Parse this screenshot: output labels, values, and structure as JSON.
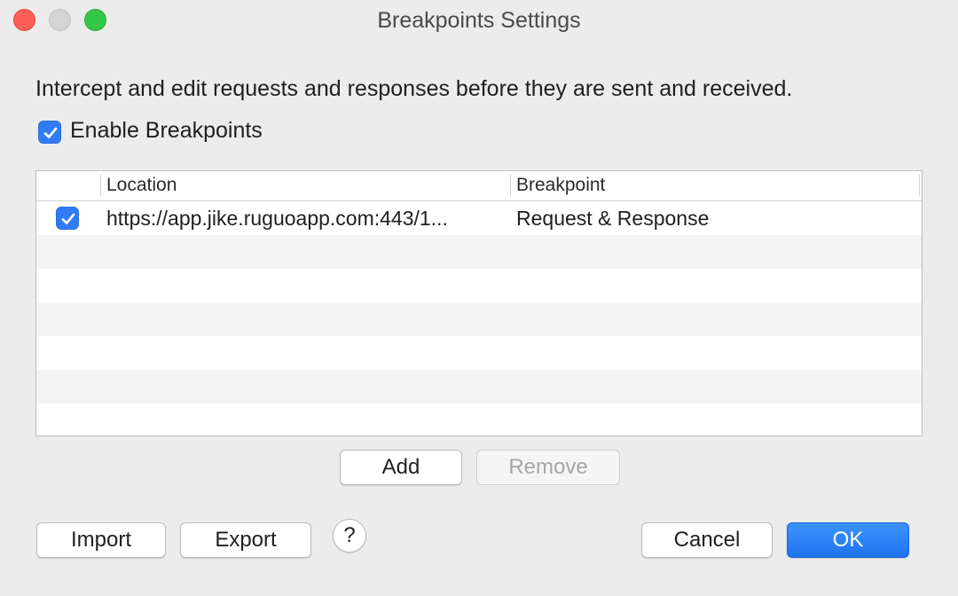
{
  "window": {
    "title": "Breakpoints Settings"
  },
  "description": "Intercept and edit requests and responses before they are sent and received.",
  "enable_breakpoints": {
    "label": "Enable Breakpoints",
    "checked": true
  },
  "table": {
    "columns": [
      "",
      "Location",
      "Breakpoint"
    ],
    "rows": [
      {
        "enabled": true,
        "location": "https://app.jike.ruguoapp.com:443/1...",
        "breakpoint": "Request & Response"
      }
    ]
  },
  "buttons": {
    "add": "Add",
    "remove": "Remove",
    "import": "Import",
    "export": "Export",
    "help": "?",
    "cancel": "Cancel",
    "ok": "OK"
  },
  "colors": {
    "accent": "#2f7cf6",
    "close": "#fc5f57",
    "minimize": "#d4d4d4",
    "zoom": "#34c748"
  }
}
